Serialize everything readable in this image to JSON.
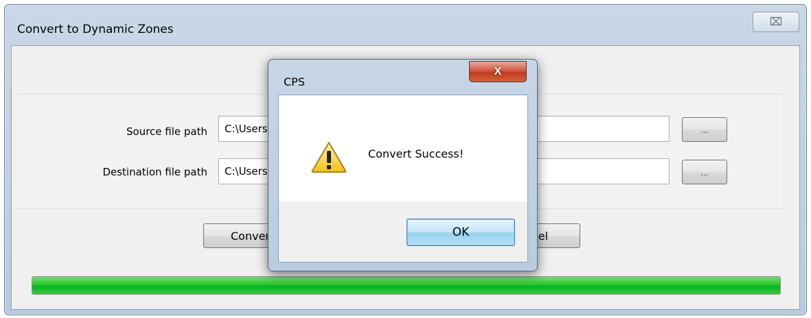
{
  "main_window": {
    "title": "Convert to Dynamic Zones",
    "close_glyph": "⌧",
    "source_label": "Source file path",
    "source_value": "C:\\Users",
    "destination_label": "Destination file path",
    "destination_value": "C:\\Users",
    "browse_label": "...",
    "convert_label": "Conver",
    "cancel_label": "cel",
    "progress_percent": 100,
    "progress_color": "#06b025"
  },
  "dialog": {
    "title": "CPS",
    "close_glyph": "X",
    "icon": "warning-icon",
    "message": "Convert Success!",
    "ok_label": "OK"
  }
}
